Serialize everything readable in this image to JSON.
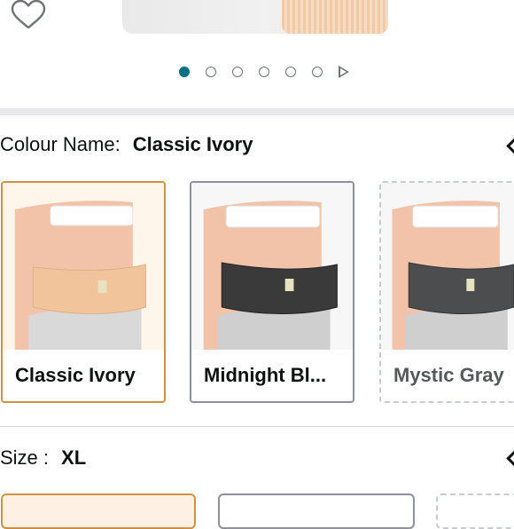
{
  "gallery": {
    "favorite_icon": "heart-icon",
    "dots": [
      {
        "active": true
      },
      {
        "active": false
      },
      {
        "active": false
      },
      {
        "active": false
      },
      {
        "active": false
      },
      {
        "active": false
      }
    ],
    "next_icon": "play-icon",
    "active_color": "#007185"
  },
  "colour": {
    "label": "Colour Name:",
    "selected": "Classic Ivory",
    "options": [
      {
        "name": "Classic Ivory",
        "selected": true
      },
      {
        "name": "Midnight Bl...",
        "selected": false
      },
      {
        "name": "Mystic Gray",
        "selected": false
      }
    ],
    "selected_border_color": "#d29142"
  },
  "size": {
    "label": "Size :",
    "selected": "XL"
  }
}
